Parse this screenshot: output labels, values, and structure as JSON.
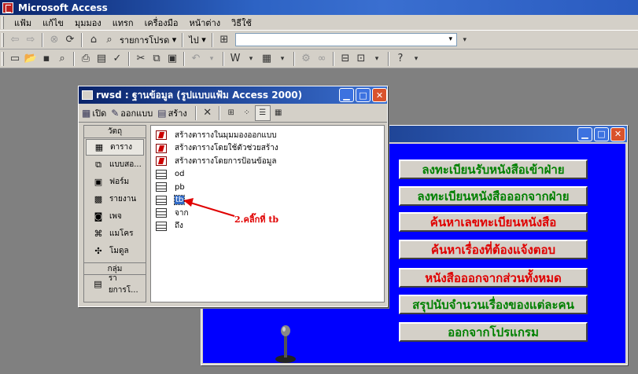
{
  "app": {
    "title": "Microsoft Access"
  },
  "menu": [
    "แฟ้ม",
    "แก้ไข",
    "มุมมอง",
    "แทรก",
    "เครื่องมือ",
    "หน้าต่าง",
    "วิธีใช้"
  ],
  "toolbar_web": {
    "favorites_label": "รายการโปรด",
    "go_label": "ไป",
    "address_value": ""
  },
  "db_window": {
    "title": "rwsd : ฐานข้อมูล (รูปแบบแฟ้ม Access 2000)",
    "toolbar": {
      "open_label": "เปิด",
      "design_label": "ออกแบบ",
      "new_label": "สร้าง"
    },
    "objects_header": "วัตถุ",
    "objects": [
      {
        "label": "ตาราง",
        "icon": "table-icon",
        "selected": true
      },
      {
        "label": "แบบสอ...",
        "icon": "query-icon",
        "selected": false
      },
      {
        "label": "ฟอร์ม",
        "icon": "form-icon",
        "selected": false
      },
      {
        "label": "รายงาน",
        "icon": "report-icon",
        "selected": false
      },
      {
        "label": "เพจ",
        "icon": "page-icon",
        "selected": false
      },
      {
        "label": "แมโคร",
        "icon": "macro-icon",
        "selected": false
      },
      {
        "label": "โมดูล",
        "icon": "module-icon",
        "selected": false
      }
    ],
    "groups_header": "กลุ่ม",
    "groups": [
      {
        "label": "รายการโ...",
        "icon": "favorites-folder-icon"
      }
    ],
    "list": [
      {
        "label": "สร้างตารางในมุมมองออกแบบ",
        "icon": "wizard-icon"
      },
      {
        "label": "สร้างตารางโดยใช้ตัวช่วยสร้าง",
        "icon": "wizard-icon"
      },
      {
        "label": "สร้างตารางโดยการป้อนข้อมูล",
        "icon": "wizard-icon"
      },
      {
        "label": "od",
        "icon": "table-icon"
      },
      {
        "label": "pb",
        "icon": "table-icon"
      },
      {
        "label": "tb",
        "icon": "table-icon",
        "selected": true
      },
      {
        "label": "จาก",
        "icon": "table-icon"
      },
      {
        "label": "ถึง",
        "icon": "table-icon"
      }
    ]
  },
  "form_window": {
    "buttons": [
      {
        "label": "ลงทะเบียนรับหนังสือเข้าฝ่าย",
        "color": "#008000"
      },
      {
        "label": "ลงทะเบียนหนังสือออกจากฝ่าย",
        "color": "#008000"
      },
      {
        "label": "ค้นหาเลขทะเบียนหนังสือ",
        "color": "#e00000"
      },
      {
        "label": "ค้นหาเรื่องที่ต้องแจ้งตอบ",
        "color": "#e00000"
      },
      {
        "label": "หนังสือออกจากส่วนทั้งหมด",
        "color": "#e00000"
      },
      {
        "label": "สรุปนับจำนวนเรื่องของแต่ละคน",
        "color": "#008000"
      },
      {
        "label": "ออกจากโปรแกรม",
        "color": "#008000"
      }
    ]
  },
  "annotation": {
    "text": "2.คลิ๊กที่ tb",
    "color": "#e00000"
  }
}
